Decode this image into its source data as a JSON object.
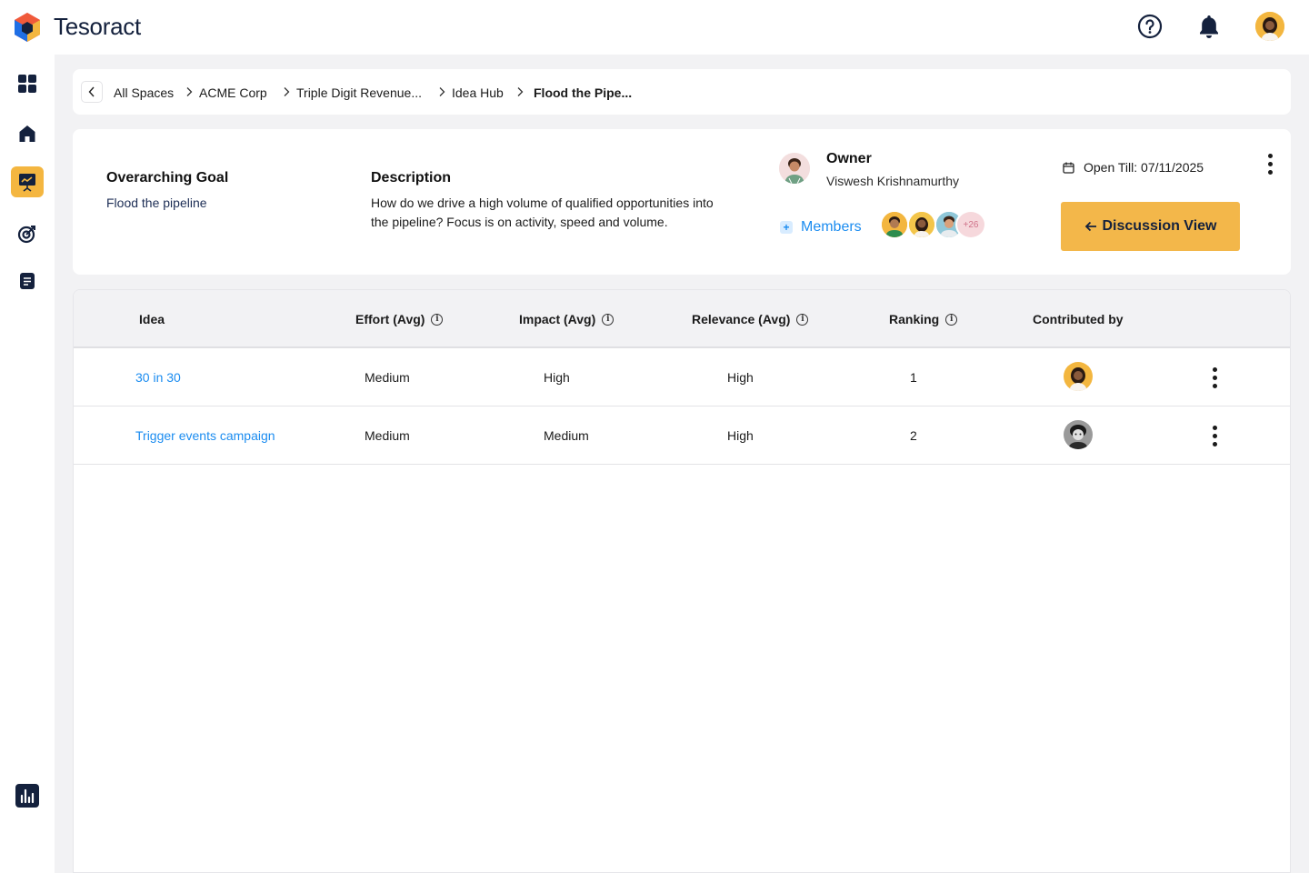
{
  "app": {
    "brand": "Tesoract"
  },
  "breadcrumb": {
    "items": [
      "All Spaces",
      "ACME Corp",
      "Triple Digit Revenue...",
      "Idea Hub"
    ],
    "current": "Flood the Pipe..."
  },
  "info": {
    "goal_label": "Overarching Goal",
    "goal_value": "Flood the pipeline",
    "description_label": "Description",
    "description_value": "How do we drive a high volume of qualified opportunities into the pipeline? Focus is on activity, speed and volume.",
    "owner_label": "Owner",
    "owner_name": "Viswesh Krishnamurthy",
    "members_label": "Members",
    "members_more": "+26",
    "open_till": "Open Till: 07/11/2025",
    "discussion_button": "Discussion View"
  },
  "table": {
    "columns": [
      "Idea",
      "Effort (Avg)",
      "Impact (Avg)",
      "Relevance (Avg)",
      "Ranking",
      "Contributed by"
    ],
    "rows": [
      {
        "idea": "30 in 30",
        "effort": "Medium",
        "impact": "High",
        "relevance": "High",
        "ranking": "1"
      },
      {
        "idea": "Trigger events campaign",
        "effort": "Medium",
        "impact": "Medium",
        "relevance": "High",
        "ranking": "2"
      }
    ]
  },
  "colors": {
    "accent": "#f3b74a",
    "link": "#1b8cf0",
    "navy": "#14213d"
  },
  "icons": [
    "logo-icon",
    "help-icon",
    "bell-icon",
    "dashboard-icon",
    "home-icon",
    "presentation-icon",
    "target-icon",
    "document-icon",
    "analytics-icon",
    "calendar-icon",
    "info-icon",
    "kebab-icon",
    "arrow-left-icon",
    "chevron-left-icon",
    "chevron-right-icon"
  ]
}
